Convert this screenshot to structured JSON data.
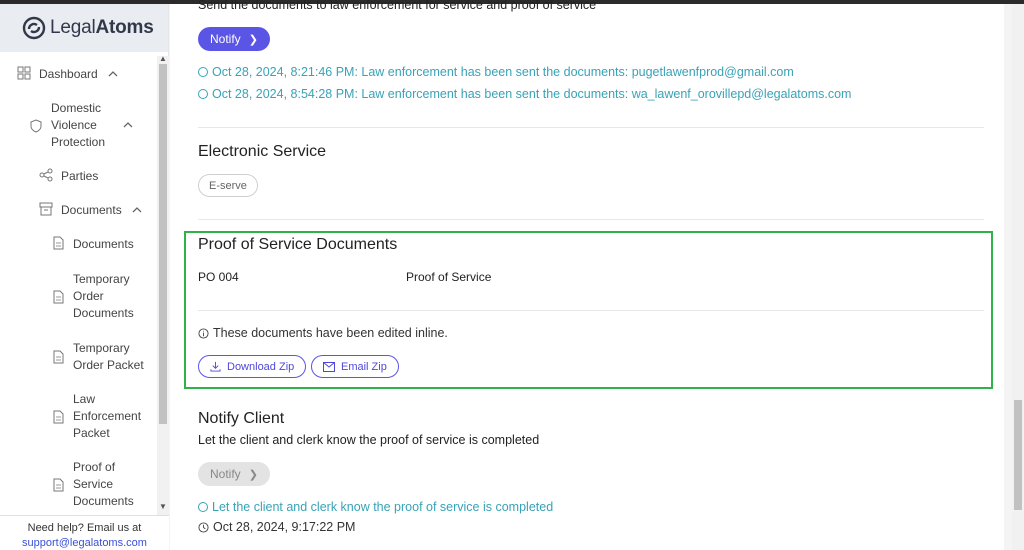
{
  "brand": {
    "name_prefix": "Legal",
    "name_suffix": "Atoms"
  },
  "sidebar": {
    "items": [
      {
        "label": "Dashboard",
        "icon": "grid-icon"
      },
      {
        "label_lines": [
          "Domestic",
          "Violence",
          "Protection"
        ],
        "icon": "shield-icon"
      },
      {
        "label": "Parties",
        "icon": "share-icon"
      },
      {
        "label": "Documents",
        "icon": "archive-icon"
      },
      {
        "label": "Documents",
        "icon": "file-icon"
      },
      {
        "label_lines": [
          "Temporary",
          "Order",
          "Documents"
        ],
        "icon": "file-icon"
      },
      {
        "label_lines": [
          "Temporary",
          "Order Packet"
        ],
        "icon": "file-icon"
      },
      {
        "label_lines": [
          "Law",
          "Enforcement",
          "Packet"
        ],
        "icon": "file-icon"
      },
      {
        "label_lines": [
          "Proof of",
          "Service",
          "Documents"
        ],
        "icon": "file-icon"
      }
    ],
    "help_text": "Need help? Email us at",
    "help_email": "support@legalatoms.com"
  },
  "main": {
    "top_text": "Send the documents to law enforcement for service and proof of service",
    "notify_button": "Notify",
    "law_logs": [
      "Oct 28, 2024, 8:21:46 PM: Law enforcement has been sent the documents: pugetlawenfprod@gmail.com",
      "Oct 28, 2024, 8:54:28 PM: Law enforcement has been sent the documents: wa_lawenf_orovillepd@legalatoms.com"
    ],
    "electronic_service": {
      "title": "Electronic Service",
      "pill": "E-serve"
    },
    "proof_of_service": {
      "title": "Proof of Service Documents",
      "doc_code": "PO 004",
      "doc_name": "Proof of Service",
      "note": "These documents have been edited inline.",
      "download_button": "Download Zip",
      "email_button": "Email Zip"
    },
    "notify_client": {
      "title": "Notify Client",
      "description": "Let the client and clerk know the proof of service is completed",
      "button": "Notify",
      "log": "Let the client and clerk know the proof of service is completed",
      "timestamp": "Oct 28, 2024, 9:17:22 PM"
    }
  },
  "colors": {
    "primary": "#5b55e6",
    "success_outline": "#2fb24a",
    "log_teal": "#38a3b7"
  }
}
